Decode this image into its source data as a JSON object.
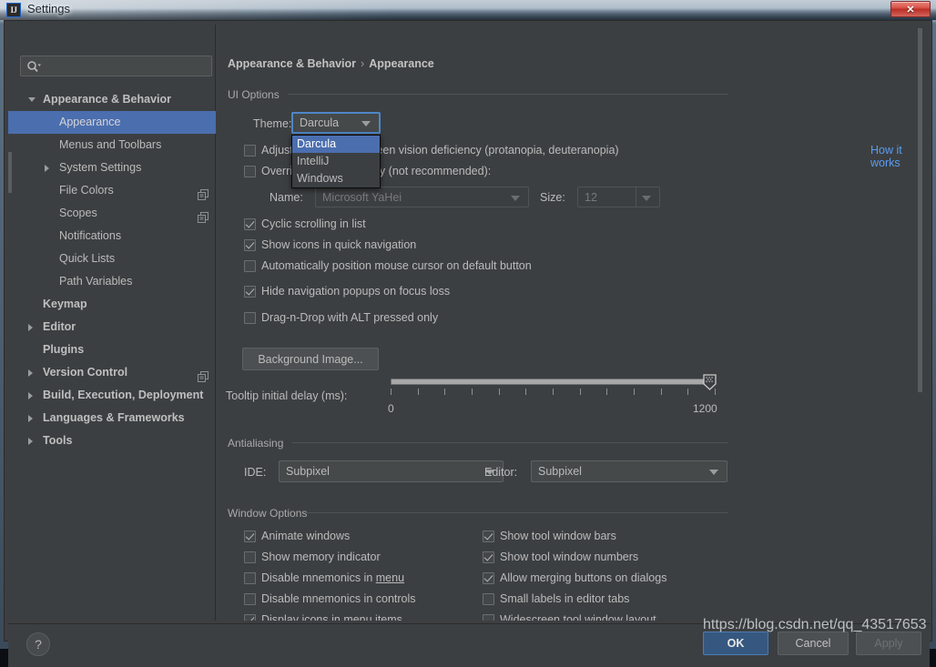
{
  "window": {
    "title": "Settings",
    "app_icon_text": "IJ",
    "close_label": "✕"
  },
  "sidebar": {
    "search_placeholder": "",
    "search_value": "",
    "items": [
      {
        "label": "Appearance & Behavior",
        "level": 0,
        "bold": true,
        "arrow": "down",
        "selected": false,
        "icon": ""
      },
      {
        "label": "Appearance",
        "level": 1,
        "bold": false,
        "arrow": "",
        "selected": true,
        "icon": ""
      },
      {
        "label": "Menus and Toolbars",
        "level": 1,
        "bold": false,
        "arrow": "",
        "selected": false,
        "icon": ""
      },
      {
        "label": "System Settings",
        "level": 1,
        "bold": false,
        "arrow": "right",
        "selected": false,
        "icon": ""
      },
      {
        "label": "File Colors",
        "level": 1,
        "bold": false,
        "arrow": "",
        "selected": false,
        "icon": "copy-icon"
      },
      {
        "label": "Scopes",
        "level": 1,
        "bold": false,
        "arrow": "",
        "selected": false,
        "icon": "copy-icon"
      },
      {
        "label": "Notifications",
        "level": 1,
        "bold": false,
        "arrow": "",
        "selected": false,
        "icon": ""
      },
      {
        "label": "Quick Lists",
        "level": 1,
        "bold": false,
        "arrow": "",
        "selected": false,
        "icon": ""
      },
      {
        "label": "Path Variables",
        "level": 1,
        "bold": false,
        "arrow": "",
        "selected": false,
        "icon": ""
      },
      {
        "label": "Keymap",
        "level": 0,
        "bold": true,
        "arrow": "",
        "selected": false,
        "icon": ""
      },
      {
        "label": "Editor",
        "level": 0,
        "bold": true,
        "arrow": "right",
        "selected": false,
        "icon": ""
      },
      {
        "label": "Plugins",
        "level": 0,
        "bold": true,
        "arrow": "",
        "selected": false,
        "icon": ""
      },
      {
        "label": "Version Control",
        "level": 0,
        "bold": true,
        "arrow": "right",
        "selected": false,
        "icon": "copy-icon"
      },
      {
        "label": "Build, Execution, Deployment",
        "level": 0,
        "bold": true,
        "arrow": "right",
        "selected": false,
        "icon": ""
      },
      {
        "label": "Languages & Frameworks",
        "level": 0,
        "bold": true,
        "arrow": "right",
        "selected": false,
        "icon": ""
      },
      {
        "label": "Tools",
        "level": 0,
        "bold": true,
        "arrow": "right",
        "selected": false,
        "icon": ""
      }
    ]
  },
  "breadcrumb": {
    "root": "Appearance & Behavior",
    "separator": "›",
    "leaf": "Appearance"
  },
  "ui_options": {
    "group_label": "UI Options",
    "theme_label": "Theme:",
    "theme_value": "Darcula",
    "theme_options": [
      "Darcula",
      "IntelliJ",
      "Windows"
    ],
    "theme_selected_index": 0,
    "adjust_colors_label": "Adjust colors for red-green vision deficiency (protanopia, deuteranopia)",
    "adjust_colors_checked": false,
    "how_it_works_link": "How it works",
    "override_label": "Override default fonts by (not recommended):",
    "override_checked": false,
    "font_name_label": "Name:",
    "font_name_value": "Microsoft YaHei",
    "font_size_label": "Size:",
    "font_size_value": "12",
    "checkboxes": [
      {
        "label": "Cyclic scrolling in list",
        "checked": true
      },
      {
        "label": "Show icons in quick navigation",
        "checked": true
      },
      {
        "label": "Automatically position mouse cursor on default button",
        "checked": false
      },
      {
        "label": "Hide navigation popups on focus loss",
        "checked": true
      },
      {
        "label": "Drag-n-Drop with ALT pressed only",
        "checked": false
      }
    ],
    "background_image_button": "Background Image...",
    "tooltip_delay_label": "Tooltip initial delay (ms):",
    "tooltip_delay_min": "0",
    "tooltip_delay_max": "1200",
    "tooltip_delay_value": 1200
  },
  "antialiasing": {
    "group_label": "Antialiasing",
    "ide_label": "IDE:",
    "ide_value": "Subpixel",
    "editor_label": "Editor:",
    "editor_value": "Subpixel"
  },
  "window_options": {
    "group_label": "Window Options",
    "left_column": [
      {
        "label": "Animate windows",
        "checked": true,
        "mnemonic": ""
      },
      {
        "label": "Show memory indicator",
        "checked": false,
        "mnemonic": ""
      },
      {
        "label": "Disable mnemonics in menu",
        "checked": false,
        "mnemonic": "menu"
      },
      {
        "label": "Disable mnemonics in controls",
        "checked": false,
        "mnemonic": ""
      },
      {
        "label": "Display icons in menu items",
        "checked": true,
        "mnemonic": ""
      }
    ],
    "right_column": [
      {
        "label": "Show tool window bars",
        "checked": true,
        "mnemonic": ""
      },
      {
        "label": "Show tool window numbers",
        "checked": true,
        "mnemonic": ""
      },
      {
        "label": "Allow merging buttons on dialogs",
        "checked": true,
        "mnemonic": ""
      },
      {
        "label": "Small labels in editor tabs",
        "checked": false,
        "mnemonic": ""
      },
      {
        "label": "Widescreen tool window layout",
        "checked": false,
        "mnemonic": ""
      }
    ]
  },
  "footer": {
    "help_label": "?",
    "ok_label": "OK",
    "cancel_label": "Cancel",
    "apply_label": "Apply"
  },
  "watermark": "https://blog.csdn.net/qq_43517653",
  "colors": {
    "panel_bg": "#3c3f41",
    "selection_blue": "#4b6eaf",
    "link_blue": "#589df6",
    "default_button_blue": "#365880",
    "focus_border": "#4e86c7"
  }
}
